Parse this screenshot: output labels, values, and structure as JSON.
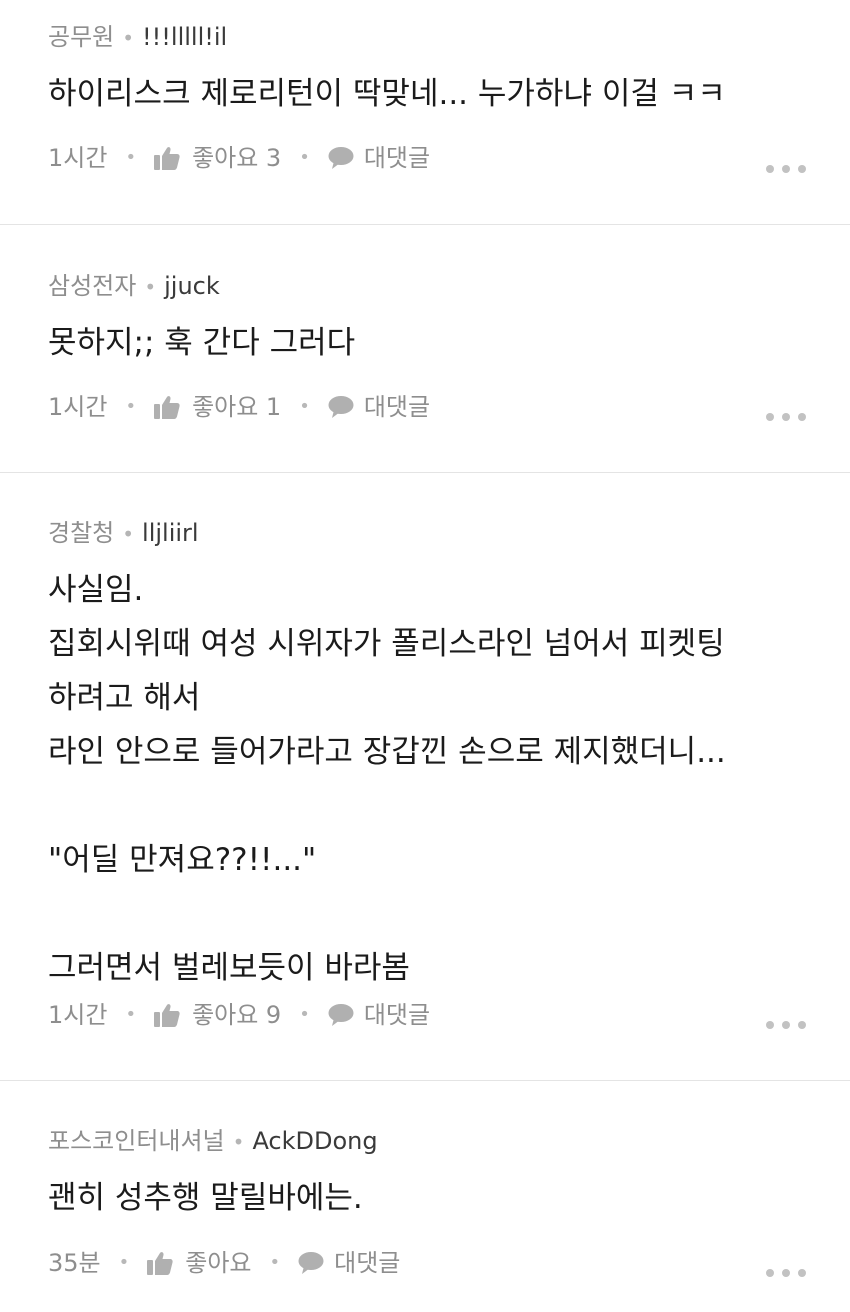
{
  "comments": [
    {
      "company": "공무원",
      "nickname": "!!!lllll!il",
      "text": "하이리스크 제로리턴이 딱맞네... 누가하냐 이걸 ㅋㅋ",
      "time": "1시간",
      "like_label": "좋아요 3",
      "reply_label": "대댓글"
    },
    {
      "company": "삼성전자",
      "nickname": "jjuck",
      "text": "못하지;; 훅 간다 그러다",
      "time": "1시간",
      "like_label": "좋아요 1",
      "reply_label": "대댓글"
    },
    {
      "company": "경찰청",
      "nickname": "lljliirl",
      "text": "사실임.\n집회시위때 여성 시위자가 폴리스라인 넘어서 피켓팅\n하려고 해서\n라인 안으로 들어가라고 장갑낀 손으로 제지했더니...\n\n\"어딜 만져요??!!...\"\n\n그러면서 벌레보듯이 바라봄",
      "time": "1시간",
      "like_label": "좋아요 9",
      "reply_label": "대댓글"
    },
    {
      "company": "포스코인터내셔널",
      "nickname": "AckDDong",
      "text": "괜히 성추행 말릴바에는.",
      "time": "35분",
      "like_label": "좋아요",
      "reply_label": "대댓글"
    }
  ],
  "colors": {
    "meta": "#8e8e8e",
    "text": "#1b1b1b",
    "divider": "#e4e4e4",
    "icon": "#b0b0b0"
  },
  "icons": {
    "like": "thumbs-up-icon",
    "reply": "speech-bubble-icon",
    "more": "more-dots-icon"
  }
}
